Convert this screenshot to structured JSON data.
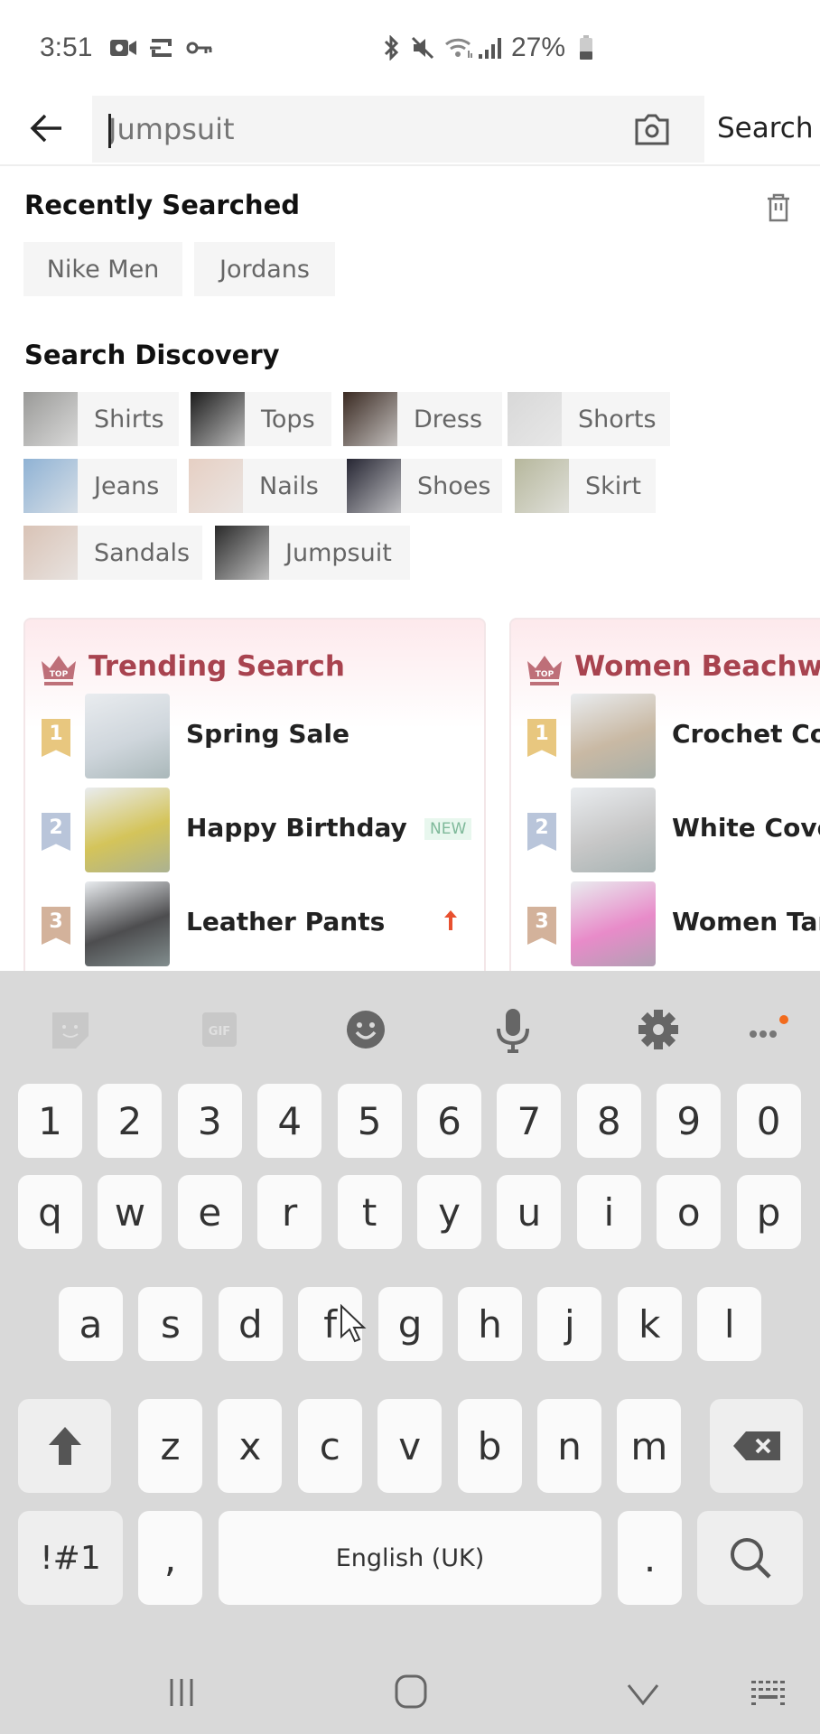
{
  "status_bar": {
    "time": "3:51",
    "left_icons": [
      "video-camera-icon",
      "cast-icon",
      "vpn-key-icon"
    ],
    "right_icons": [
      "bluetooth-icon",
      "mute-icon",
      "wifi-icon",
      "signal-icon",
      "battery-icon"
    ],
    "battery_percent": "27%"
  },
  "search": {
    "value": "",
    "placeholder": "Jumpsuit",
    "submit_label": "Search"
  },
  "recent": {
    "title": "Recently Searched",
    "items": [
      "Nike Men",
      "Jordans"
    ]
  },
  "discovery": {
    "title": "Search Discovery",
    "items": [
      {
        "label": "Shirts",
        "thumb_color": "#9a9a98"
      },
      {
        "label": "Tops",
        "thumb_color": "#1d1d1d"
      },
      {
        "label": "Dress",
        "thumb_color": "#3a2a22"
      },
      {
        "label": "Shorts",
        "thumb_color": "#d8d8d8"
      },
      {
        "label": "Jeans",
        "thumb_color": "#8fb2d4"
      },
      {
        "label": "Nails",
        "thumb_color": "#e6cfc3"
      },
      {
        "label": "Shoes",
        "thumb_color": "#262633"
      },
      {
        "label": "Skirt",
        "thumb_color": "#b6b79c"
      },
      {
        "label": "Sandals",
        "thumb_color": "#d9c3b6"
      },
      {
        "label": "Jumpsuit",
        "thumb_color": "#2a2a2a"
      }
    ]
  },
  "rankings": [
    {
      "title": "Trending Search",
      "items": [
        {
          "rank": "1",
          "label": "Spring Sale",
          "tag": "",
          "thumb_color": "#cfd6dc"
        },
        {
          "rank": "2",
          "label": "Happy Birthday",
          "tag": "NEW",
          "thumb_color": "#d4c45a"
        },
        {
          "rank": "3",
          "label": "Leather Pants",
          "tag": "up",
          "thumb_color": "#4d4d4f"
        }
      ]
    },
    {
      "title": "Women Beachwear",
      "items": [
        {
          "rank": "1",
          "label": "Crochet Cover",
          "tag": "",
          "thumb_color": "#c9b9a4"
        },
        {
          "rank": "2",
          "label": "White Cover",
          "tag": "",
          "thumb_color": "#c7c7c7"
        },
        {
          "rank": "3",
          "label": "Women Tank",
          "tag": "",
          "thumb_color": "#e88bc9"
        }
      ]
    }
  ],
  "rank_colors": {
    "1": "#e8c77f",
    "2": "#b9c5da",
    "3": "#d3b29b"
  },
  "accent_color": "#a8434f",
  "keyboard": {
    "toolbar": [
      "sticker-icon",
      "gif-icon",
      "emoji-icon",
      "microphone-icon",
      "settings-icon",
      "more-icon"
    ],
    "gif_label": "GIF",
    "row_numbers": [
      "1",
      "2",
      "3",
      "4",
      "5",
      "6",
      "7",
      "8",
      "9",
      "0"
    ],
    "row_1": [
      "q",
      "w",
      "e",
      "r",
      "t",
      "y",
      "u",
      "i",
      "o",
      "p"
    ],
    "row_2": [
      "a",
      "s",
      "d",
      "f",
      "g",
      "h",
      "j",
      "k",
      "l"
    ],
    "row_3": [
      "z",
      "x",
      "c",
      "v",
      "b",
      "n",
      "m"
    ],
    "symbols_label": "!#1",
    "comma_label": ",",
    "space_label": "English (UK)",
    "period_label": "."
  },
  "nav_bar": [
    "recent-apps-icon",
    "home-icon",
    "back-down-icon",
    "keyboard-switch-icon"
  ]
}
